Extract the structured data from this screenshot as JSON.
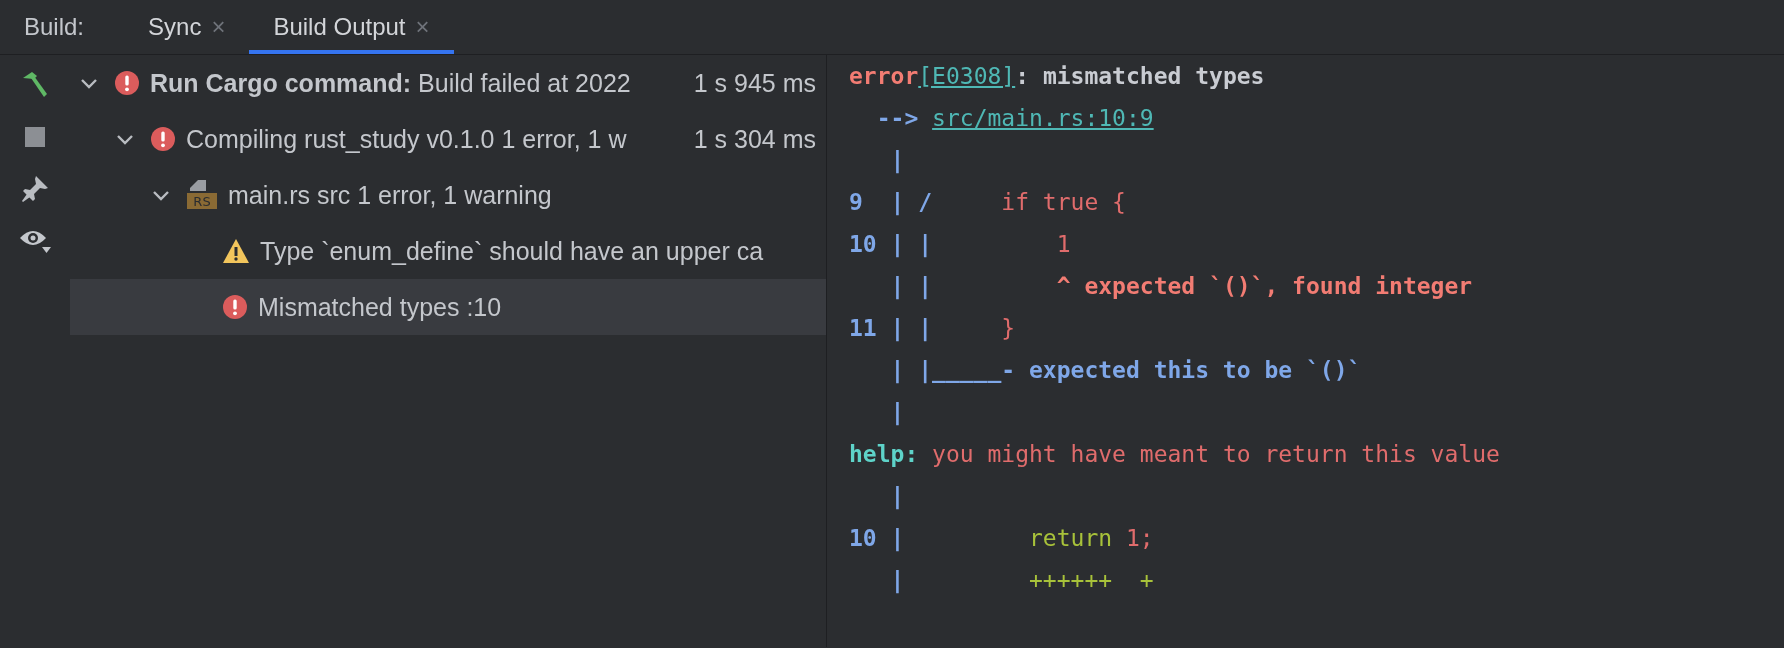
{
  "tool_window": {
    "title": "Build:",
    "tabs": [
      {
        "label": "Sync",
        "close": "×",
        "selected": false
      },
      {
        "label": "Build Output",
        "close": "×",
        "selected": true
      }
    ]
  },
  "toolbar": [
    {
      "kind": "hammer"
    },
    {
      "kind": "stop"
    },
    {
      "kind": "pin"
    },
    {
      "kind": "eye"
    }
  ],
  "tree": [
    {
      "kind": "error",
      "label": "**Run Cargo command:** Build failed at 2022",
      "time": "1 s 945 ms",
      "expanded": true,
      "selected": false,
      "children": [
        {
          "kind": "error",
          "label": "Compiling rust_study v0.1.0  1 error, 1 w",
          "time": "1 s 304 ms",
          "expanded": true,
          "selected": false,
          "children": [
            {
              "kind": "file",
              "badge": "RS",
              "label": "main.rs src 1 error, 1 warning",
              "expanded": true,
              "selected": false,
              "children": [
                {
                  "kind": "warning",
                  "label": "Type `enum_define` should have an upper ca",
                  "selected": false
                },
                {
                  "kind": "error",
                  "label": "Mismatched types :10",
                  "selected": true
                }
              ]
            }
          ]
        }
      ]
    }
  ],
  "console": [
    {
      "segments": [
        {
          "kind": "error",
          "text": "error"
        },
        {
          "kind": "link",
          "text": "[E0308]"
        },
        {
          "kind": "plain",
          "text": ": mismatched types"
        }
      ]
    },
    {
      "segments": [
        {
          "kind": "gutter",
          "text": "  --> "
        },
        {
          "kind": "link",
          "text": "src/main.rs:10:9"
        }
      ]
    },
    {
      "segments": [
        {
          "kind": "gutter",
          "text": "   |"
        }
      ]
    },
    {
      "segments": [
        {
          "kind": "gutter",
          "text": "9  | / "
        },
        {
          "kind": "code",
          "text": "    if true {"
        }
      ]
    },
    {
      "segments": [
        {
          "kind": "gutter",
          "text": "10 | | "
        },
        {
          "kind": "code",
          "text": "        1"
        }
      ]
    },
    {
      "segments": [
        {
          "kind": "gutter",
          "text": "   | | "
        },
        {
          "kind": "error",
          "text": "        ^ expected `()`, found integer"
        }
      ]
    },
    {
      "segments": [
        {
          "kind": "gutter",
          "text": "11 | | "
        },
        {
          "kind": "code",
          "text": "    }"
        }
      ]
    },
    {
      "segments": [
        {
          "kind": "gutter",
          "text": "   | |_____- expected this to be `()`"
        }
      ]
    },
    {
      "segments": [
        {
          "kind": "gutter",
          "text": "   |"
        }
      ]
    },
    {
      "segments": [
        {
          "kind": "help",
          "text": "help:"
        },
        {
          "kind": "code",
          "text": " you might have meant to return this value"
        }
      ]
    },
    {
      "segments": [
        {
          "kind": "gutter",
          "text": "   |"
        }
      ]
    },
    {
      "segments": [
        {
          "kind": "gutter",
          "text": "10 | "
        },
        {
          "kind": "added",
          "text": "        return "
        },
        {
          "kind": "code",
          "text": "1;"
        }
      ]
    },
    {
      "segments": [
        {
          "kind": "gutter",
          "text": "   | "
        },
        {
          "kind": "added",
          "text": "        ++++++  +"
        }
      ]
    }
  ]
}
